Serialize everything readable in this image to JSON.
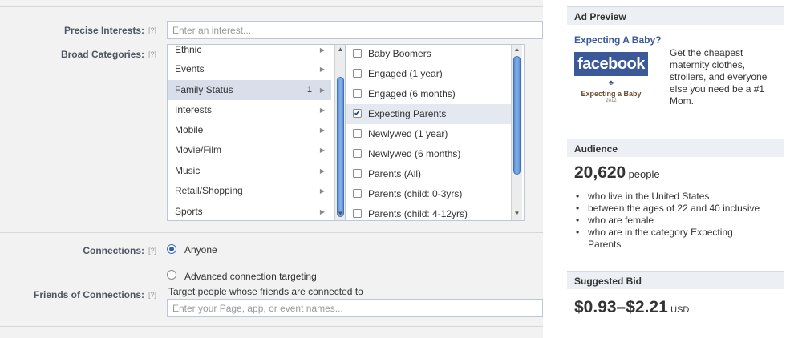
{
  "form": {
    "precise_interests": {
      "label": "Precise Interests:",
      "help": "[?]",
      "placeholder": "Enter an interest..."
    },
    "broad_categories": {
      "label": "Broad Categories:",
      "help": "[?]",
      "categories": [
        {
          "label": "Ethnic",
          "count": ""
        },
        {
          "label": "Events",
          "count": ""
        },
        {
          "label": "Family Status",
          "count": "1"
        },
        {
          "label": "Interests",
          "count": ""
        },
        {
          "label": "Mobile",
          "count": ""
        },
        {
          "label": "Movie/Film",
          "count": ""
        },
        {
          "label": "Music",
          "count": ""
        },
        {
          "label": "Retail/Shopping",
          "count": ""
        },
        {
          "label": "Sports",
          "count": ""
        }
      ],
      "selected_category": "Family Status",
      "options": [
        {
          "label": "Baby Boomers",
          "checked": false
        },
        {
          "label": "Engaged (1 year)",
          "checked": false
        },
        {
          "label": "Engaged (6 months)",
          "checked": false
        },
        {
          "label": "Expecting Parents",
          "checked": true
        },
        {
          "label": "Newlywed (1 year)",
          "checked": false
        },
        {
          "label": "Newlywed (6 months)",
          "checked": false
        },
        {
          "label": "Parents (All)",
          "checked": false
        },
        {
          "label": "Parents (child: 0-3yrs)",
          "checked": false
        },
        {
          "label": "Parents (child: 4-12yrs)",
          "checked": false
        }
      ]
    },
    "connections": {
      "label": "Connections:",
      "help": "[?]",
      "anyone": "Anyone",
      "advanced": "Advanced connection targeting"
    },
    "friends_of_connections": {
      "label": "Friends of Connections:",
      "help": "[?]",
      "description": "Target people whose friends are connected to",
      "placeholder": "Enter your Page, app, or event names..."
    }
  },
  "sidebar": {
    "ad_preview": {
      "title": "Ad Preview",
      "ad_title": "Expecting A Baby?",
      "image_logo": "facebook",
      "image_caption": "Expecting a Baby",
      "image_year": "2012",
      "body": "Get the cheapest maternity clothes, strollers, and everyone else you need be a #1 Mom."
    },
    "audience": {
      "title": "Audience",
      "count": "20,620",
      "unit": "people",
      "bullets": [
        "who live in the United States",
        "between the ages of 22 and 40 inclusive",
        "who are female",
        "who are in the category Expecting Parents"
      ]
    },
    "suggested_bid": {
      "title": "Suggested Bid",
      "range": "$0.93–$2.21",
      "currency": "USD"
    }
  },
  "colors": {
    "link": "#3b5998",
    "accent": "#3f72b8",
    "selected_row": "#d8dfea"
  }
}
